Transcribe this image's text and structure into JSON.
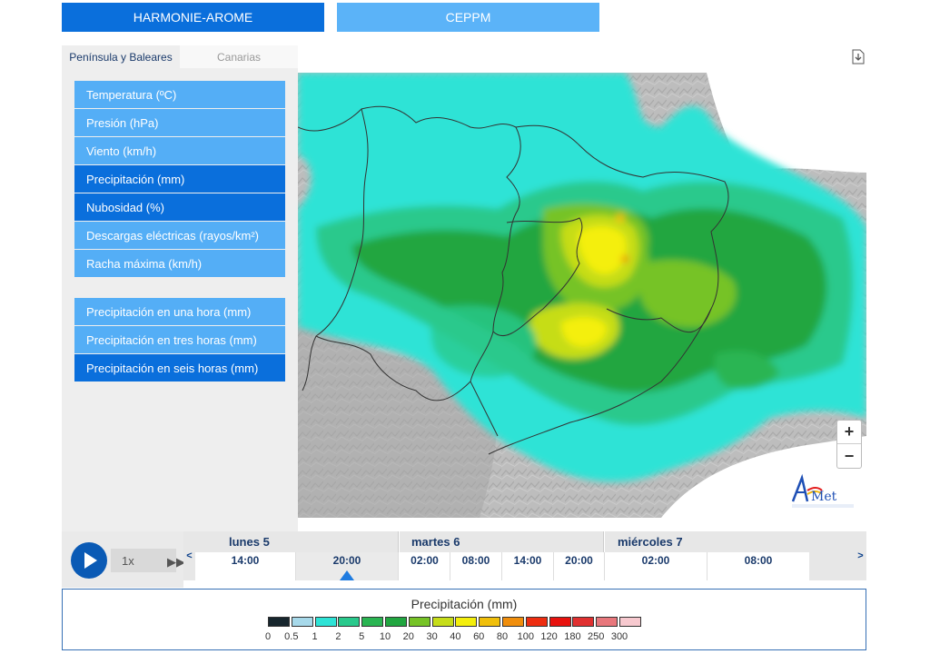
{
  "models": [
    {
      "label": "HARMONIE-AROME",
      "active": true
    },
    {
      "label": "CEPPM",
      "active": false
    }
  ],
  "region_tabs": [
    "Península y Baleares",
    "Canarias"
  ],
  "variables": [
    "Temperatura (ºC)",
    "Presión (hPa)",
    "Viento (km/h)",
    "Precipitación (mm)",
    "Nubosidad (%)",
    "Descargas eléctricas (rayos/km²)",
    "Racha máxima (km/h)"
  ],
  "precip_options": [
    "Precipitación en una hora (mm)",
    "Precipitación en tres horas (mm)",
    "Precipitación en seis horas (mm)"
  ],
  "zoom": {
    "in": "+",
    "out": "−"
  },
  "player": {
    "speed": "1x",
    "fast_forward": "▶▶"
  },
  "timeline": {
    "prev": "<",
    "next": ">",
    "days": [
      "lunes 5",
      "martes 6",
      "miércoles 7"
    ],
    "times": [
      "14:00",
      "20:00",
      "02:00",
      "08:00",
      "14:00",
      "20:00",
      "02:00",
      "08:00"
    ],
    "selected_time": "20:00"
  },
  "legend": {
    "title": "Precipitación (mm)",
    "colors": [
      "#17262d",
      "#a7d9ea",
      "#2ee3d6",
      "#29c98c",
      "#2ab552",
      "#21a640",
      "#76c326",
      "#c6dd19",
      "#f4ef0c",
      "#f0bf0a",
      "#f08e0c",
      "#ee2d10",
      "#e8120e",
      "#e03030",
      "#e8777c",
      "#f7c9cf"
    ],
    "labels": [
      "0",
      "0.5",
      "1",
      "2",
      "5",
      "10",
      "20",
      "30",
      "40",
      "60",
      "80",
      "100",
      "120",
      "180",
      "250",
      "300"
    ]
  },
  "logo_text": "AEmet",
  "logo_subtext": "Agencia Estatal de Meteorología"
}
